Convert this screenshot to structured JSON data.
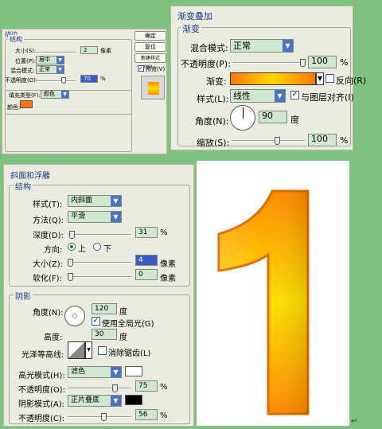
{
  "stroke_panel": {
    "title": "描边",
    "group": "结构",
    "size_label": "大小(S):",
    "size_value": "2",
    "size_unit": "像素",
    "position_label": "位置(P):",
    "position_value": "居中",
    "blend_label": "混合模式:",
    "blend_value": "正常",
    "opacity_label": "不透明度(O):",
    "opacity_value": "70",
    "opacity_unit": "%",
    "fill_type_label": "填充类型(F):",
    "fill_type_value": "颜色",
    "color_label": "颜色:",
    "color_swatch": "#ff7a0a",
    "ok": "确定",
    "reset": "复位",
    "new_style": "新建样式(W)...",
    "preview": "预览(V)"
  },
  "gradient_panel": {
    "header": "渐变叠加",
    "group": "渐变",
    "blend_label": "混合模式:",
    "blend_value": "正常",
    "opacity_label": "不透明度(P):",
    "opacity_value": "100",
    "opacity_unit": "%",
    "gradient_label": "渐变:",
    "reverse_label": "反向(R)",
    "style_label": "样式(L):",
    "style_value": "线性",
    "align_label": "与图层对齐(I)",
    "angle_label": "角度(N):",
    "angle_value": "90",
    "angle_unit": "度",
    "scale_label": "缩放(S):",
    "scale_value": "100",
    "scale_unit": "%",
    "gradient_colors": [
      "#ff7800",
      "#ffd800",
      "#ff7800"
    ]
  },
  "bevel_panel": {
    "title": "斜面和浮雕",
    "group_structure": "结构",
    "style_label": "样式(T):",
    "style_value": "内斜面",
    "method_label": "方法(Q):",
    "method_value": "平滑",
    "depth_label": "深度(D):",
    "depth_value": "31",
    "depth_unit": "%",
    "direction_label": "方向:",
    "up_label": "上",
    "down_label": "下",
    "size_label": "大小(Z):",
    "size_value": "4",
    "size_unit": "像素",
    "soften_label": "软化(F):",
    "soften_value": "0",
    "soften_unit": "像素",
    "group_shading": "阴影",
    "angle_label": "角度(N):",
    "angle_value": "120",
    "angle_unit": "度",
    "global_light_label": "使用全局光(G)",
    "altitude_label": "高度:",
    "altitude_value": "30",
    "altitude_unit": "度",
    "gloss_label": "光泽等高线:",
    "antialias_label": "消除锯齿(L)",
    "highlight_mode_label": "高光模式(H):",
    "highlight_mode_value": "滤色",
    "highlight_color": "#ffffff",
    "highlight_opacity_label": "不透明度(O):",
    "highlight_opacity_value": "75",
    "highlight_opacity_unit": "%",
    "shadow_mode_label": "阴影模式(A):",
    "shadow_mode_value": "正片叠底",
    "shadow_color": "#000000",
    "shadow_opacity_label": "不透明度(C):",
    "shadow_opacity_value": "56",
    "shadow_opacity_unit": "%"
  },
  "preview_digit": {
    "text": "1",
    "gradient_top": "#ff8a00",
    "gradient_mid": "#ffe000",
    "gradient_bottom": "#ff8a00",
    "return_mark": "↵"
  }
}
